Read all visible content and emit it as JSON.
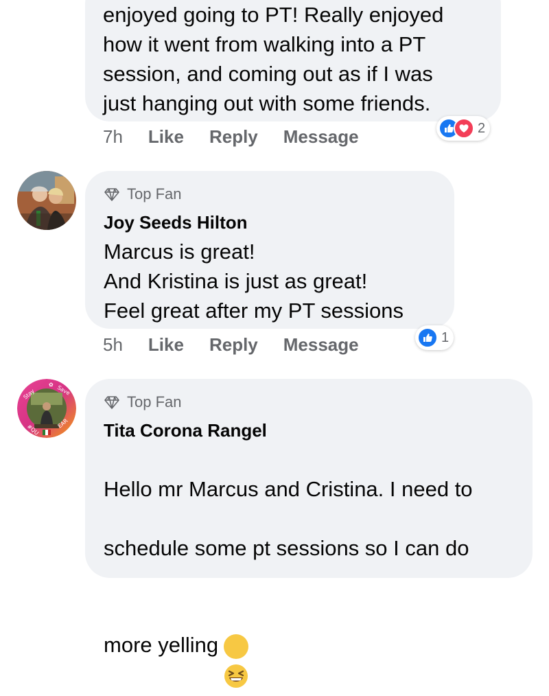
{
  "comments": [
    {
      "body": "enjoyed going to PT! Really enjoyed\nhow it went from walking into a PT\nsession, and coming out as if I was\njust hanging out with some friends.",
      "time": "7h",
      "actions": [
        "Like",
        "Reply",
        "Message"
      ],
      "reaction_count": "2",
      "reactions": [
        "like-icon",
        "love-icon"
      ]
    },
    {
      "badge": "Top Fan",
      "author": "Joy Seeds Hilton",
      "body": "Marcus is great!\nAnd Kristina is just as great!\nFeel great after my PT sessions",
      "time": "5h",
      "actions": [
        "Like",
        "Reply",
        "Message"
      ],
      "reaction_count": "1",
      "reactions": [
        "like-icon"
      ]
    },
    {
      "badge": "Top Fan",
      "author": "Tita Corona Rangel",
      "body_line1": "Hello mr Marcus and Cristina. I need to",
      "body_line2": "schedule some pt sessions so I can do",
      "body_line3": "more yelling",
      "emoji": "grinning-squinting-face-emoji",
      "avatar_frame_text": "Stay Home Save Lives"
    }
  ],
  "colors": {
    "bubble": "#f0f2f5",
    "secondary_text": "#65676b",
    "like_blue": "#1877f2",
    "love_red": "#f33e58"
  }
}
